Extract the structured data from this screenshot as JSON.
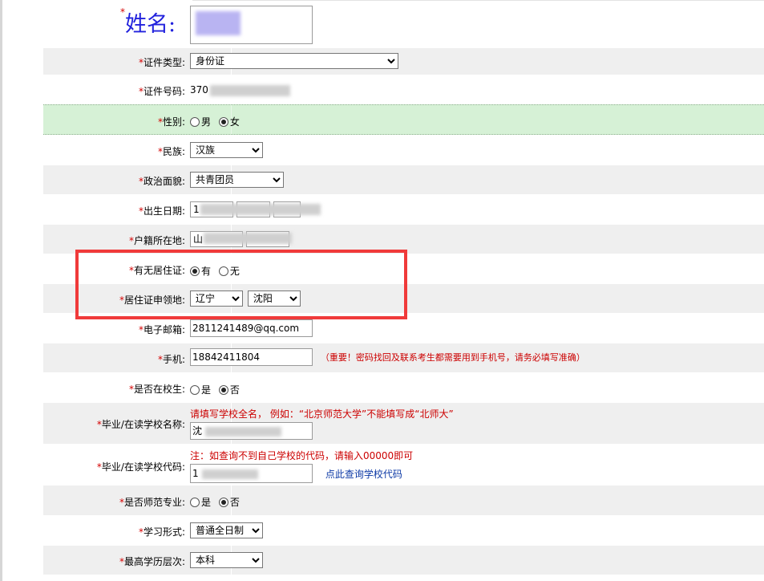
{
  "form": {
    "name_label": "姓名:",
    "id_type": {
      "label": "证件类型:",
      "value": "身份证"
    },
    "id_number": {
      "label": "证件号码:",
      "value_prefix": "370"
    },
    "gender": {
      "label": "性别:",
      "options": [
        "男",
        "女"
      ],
      "selected": "女"
    },
    "ethnicity": {
      "label": "民族:",
      "value": "汉族"
    },
    "political_status": {
      "label": "政治面貌:",
      "value": "共青团员"
    },
    "birth_date": {
      "label": "出生日期:",
      "value_prefix": "1"
    },
    "household_location": {
      "label": "户籍所在地:",
      "value_prefix": "山"
    },
    "residence_permit": {
      "label": "有无居住证:",
      "options": [
        "有",
        "无"
      ],
      "selected": "有"
    },
    "permit_location": {
      "label": "居住证申领地:",
      "province": "辽宁",
      "city": "沈阳"
    },
    "email": {
      "label": "电子邮箱:",
      "value": "2811241489@qq.com"
    },
    "phone": {
      "label": "手机:",
      "value": "18842411804",
      "note": "（重要！密码找回及联系考生都需要用到手机号，请务必填写准确）"
    },
    "is_student": {
      "label": "是否在校生:",
      "options": [
        "是",
        "否"
      ],
      "selected": "否"
    },
    "school_name": {
      "label": "毕业/在读学校名称:",
      "hint": "请填写学校全名，  例如：“北京师范大学”不能填写成“北师大”",
      "value_prefix": "沈"
    },
    "school_code": {
      "label": "毕业/在读学校代码:",
      "hint": "注：如查询不到自己学校的代码，请输入00000即可",
      "value_prefix": "1",
      "lookup_link": "点此查询学校代码"
    },
    "is_normal_major": {
      "label": "是否师范专业:",
      "options": [
        "是",
        "否"
      ],
      "selected": "否"
    },
    "study_mode": {
      "label": "学习形式:",
      "value": "普通全日制"
    },
    "education_level": {
      "label": "最高学历层次:",
      "value": "本科"
    }
  },
  "required_mark": "*",
  "colors": {
    "required": "#d40000",
    "highlight_box": "#f03a3a",
    "focus_row": "#d6f1d6",
    "note_red": "#cc0000",
    "link_blue": "#0b38a5"
  }
}
